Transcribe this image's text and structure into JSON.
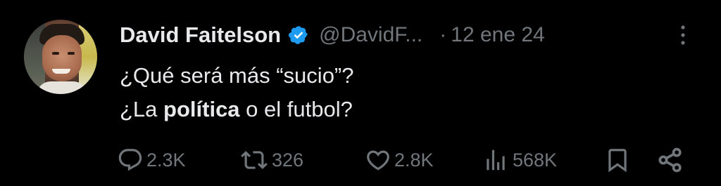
{
  "author": {
    "display_name": "David Faitelson",
    "handle": "@DavidF...",
    "verified": true,
    "avatar": "profile-photo"
  },
  "meta": {
    "separator": "·",
    "date": "12 ene 24"
  },
  "tweet": {
    "line1": "¿Qué será más “sucio”?",
    "line2_prefix": "¿La ",
    "line2_bold": "política",
    "line2_suffix": " o el futbol?"
  },
  "actions": {
    "reply": {
      "icon": "reply-icon",
      "count": "2.3K"
    },
    "retweet": {
      "icon": "retweet-icon",
      "count": "326"
    },
    "like": {
      "icon": "heart-icon",
      "count": "2.8K"
    },
    "views": {
      "icon": "views-icon",
      "count": "568K"
    },
    "bookmark": {
      "icon": "bookmark-icon"
    },
    "share": {
      "icon": "share-icon"
    }
  },
  "colors": {
    "background": "#000000",
    "primary_text": "#e7e9ea",
    "secondary_text": "#71767b",
    "verified_badge": "#1d9bf0"
  }
}
